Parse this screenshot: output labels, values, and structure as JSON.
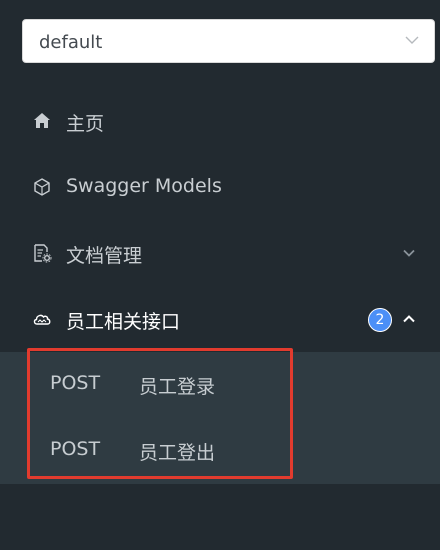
{
  "group_select": {
    "value": "default",
    "icon": "chevron-down-icon"
  },
  "menu": [
    {
      "label": "主页",
      "icon": "home-icon"
    },
    {
      "label": "Swagger Models",
      "icon": "cube-icon"
    },
    {
      "label": "文档管理",
      "icon": "document-settings-icon",
      "arrow": "chevron-down-icon"
    },
    {
      "label": "员工相关接口",
      "icon": "cloud-icon",
      "badge": "2",
      "arrow": "chevron-up-icon"
    }
  ],
  "submenu": [
    {
      "method": "POST",
      "name": "员工登录"
    },
    {
      "method": "POST",
      "name": "员工登出"
    }
  ],
  "colors": {
    "sidebar_bg": "#222a30",
    "submenu_bg": "#2f3b42",
    "badge": "#4b8ff7",
    "highlight": "#e23b2e"
  }
}
